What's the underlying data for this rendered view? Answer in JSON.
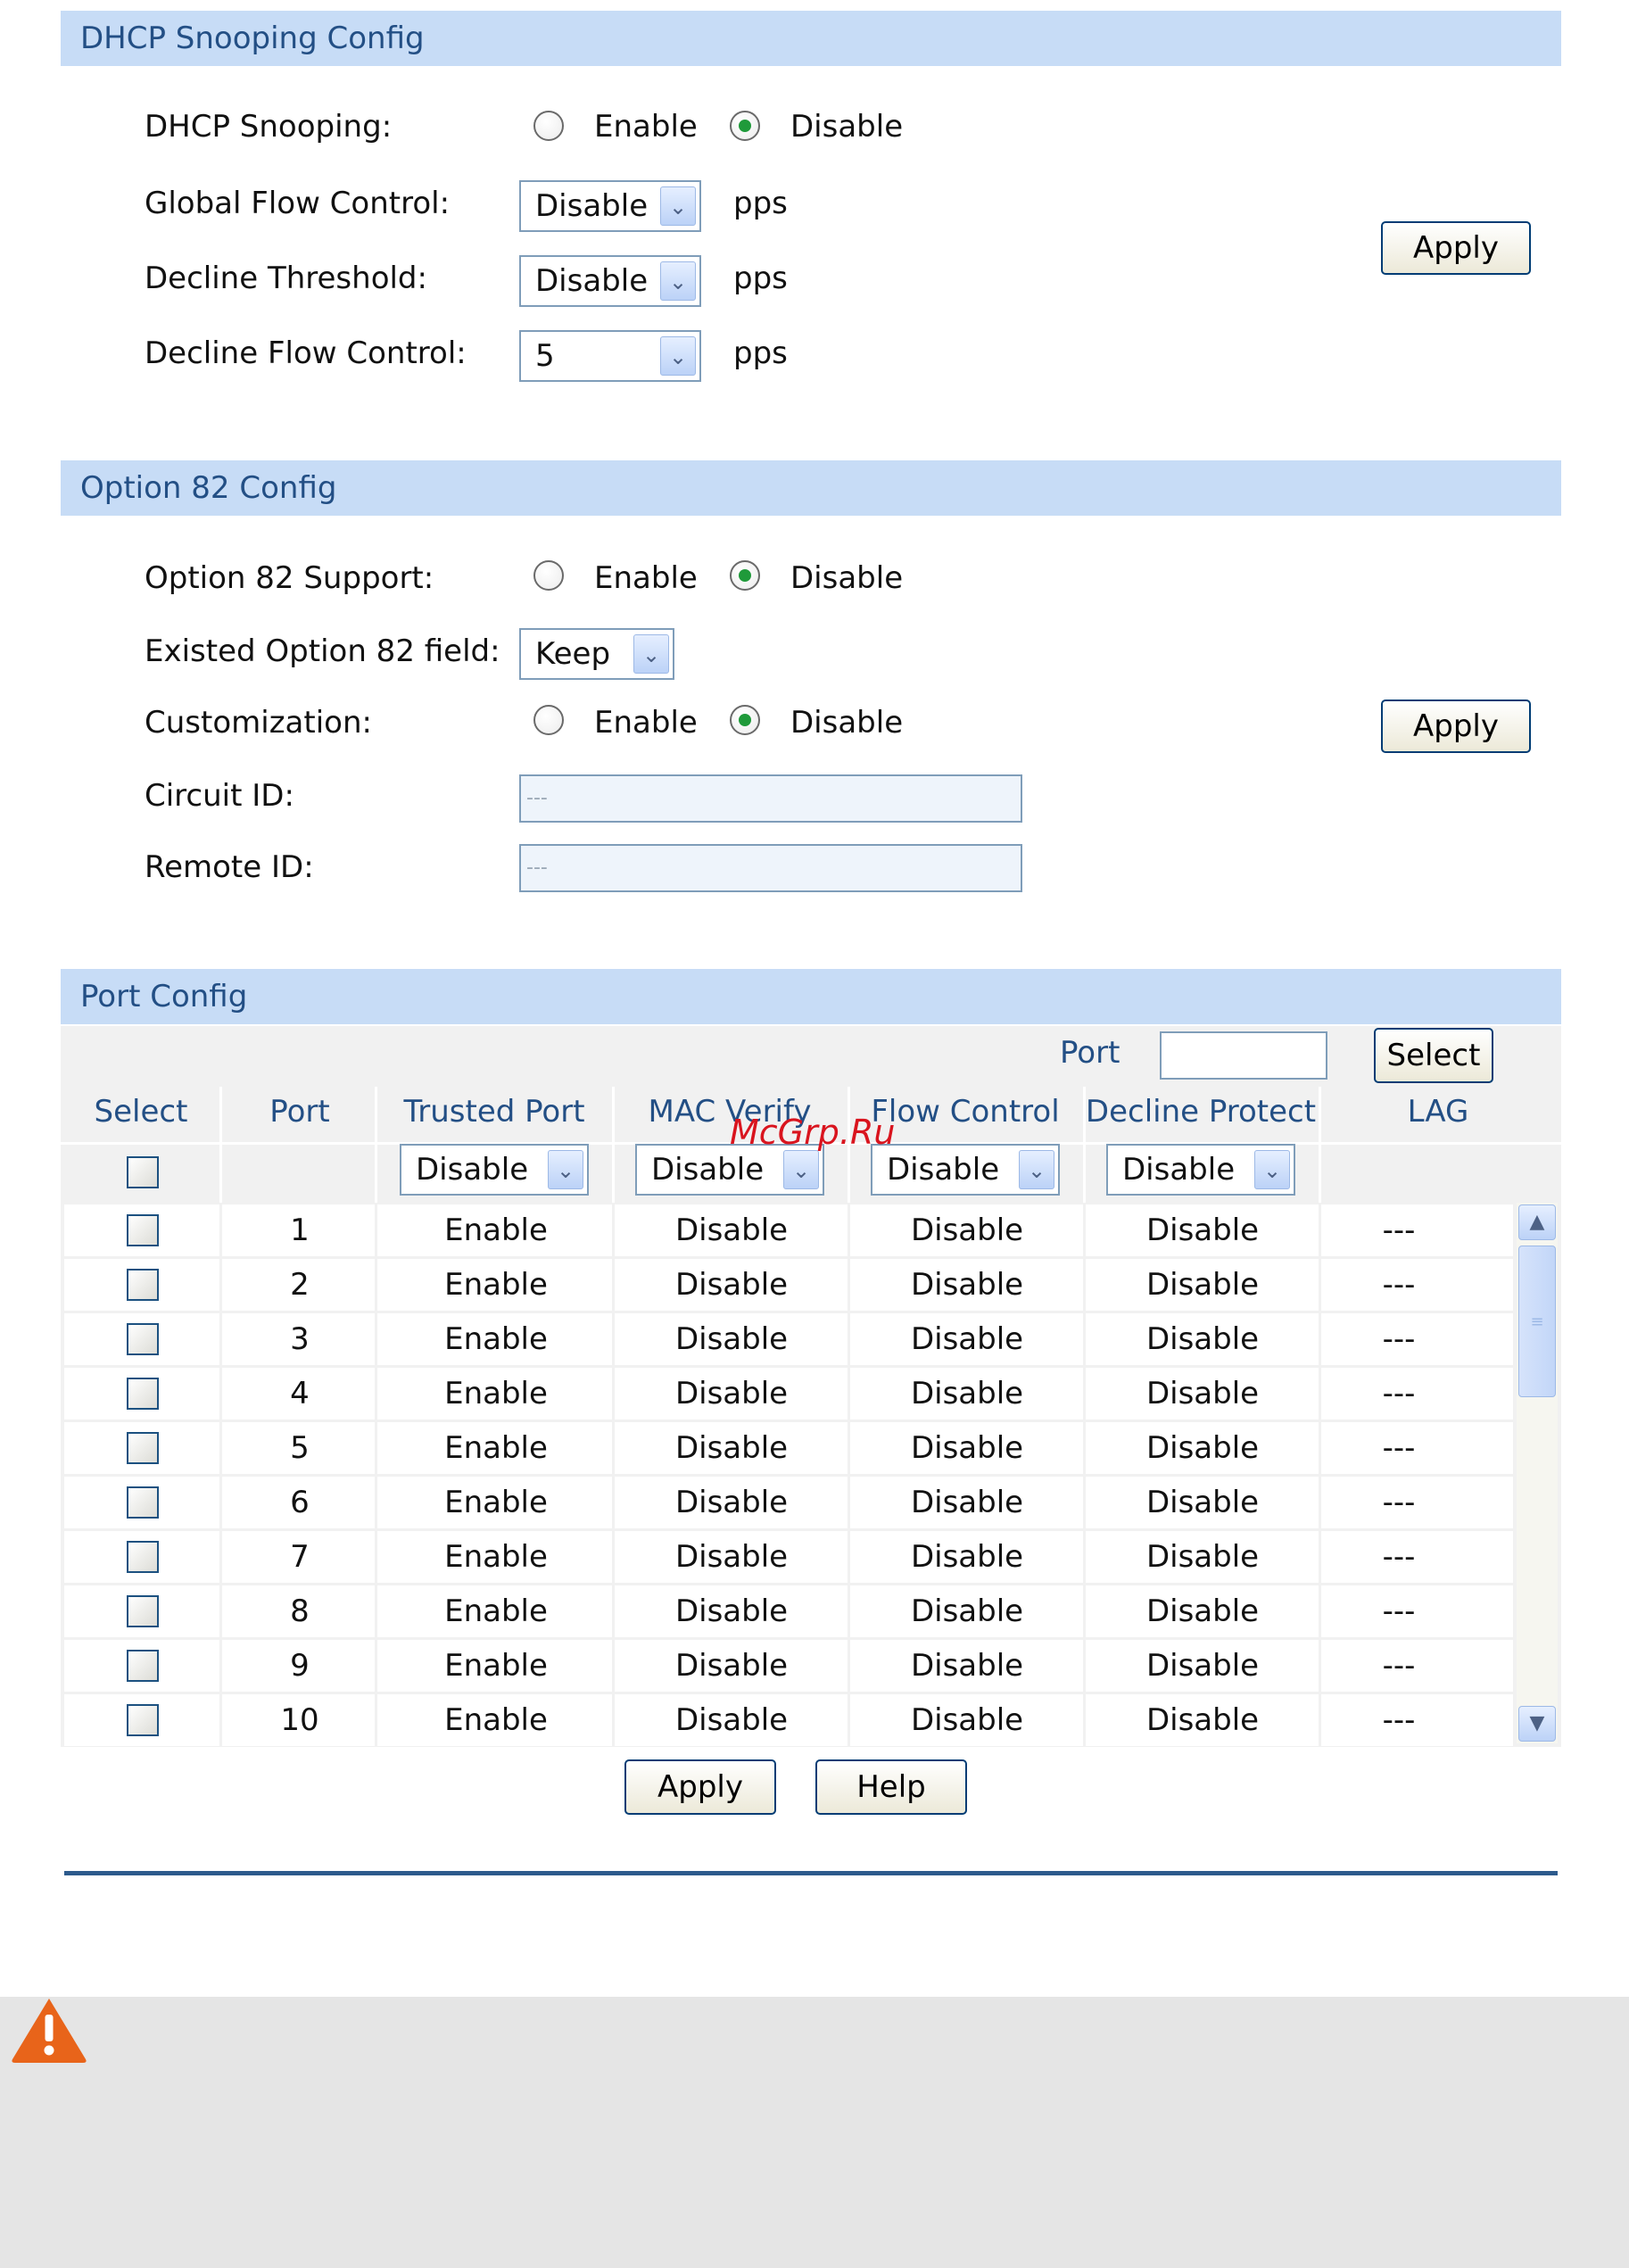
{
  "dhcp": {
    "title": "DHCP Snooping Config",
    "snooping_label": "DHCP Snooping:",
    "enable_label": "Enable",
    "disable_label": "Disable",
    "global_flow_label": "Global Flow Control:",
    "global_flow_value": "Disable",
    "decline_threshold_label": "Decline Threshold:",
    "decline_threshold_value": "Disable",
    "decline_flow_label": "Decline Flow Control:",
    "decline_flow_value": "5",
    "unit": "pps",
    "apply_label": "Apply"
  },
  "option82": {
    "title": "Option 82 Config",
    "support_label": "Option 82 Support:",
    "existed_label": "Existed Option 82 field:",
    "existed_value": "Keep",
    "custom_label": "Customization:",
    "enable_label": "Enable",
    "disable_label": "Disable",
    "circuit_label": "Circuit ID:",
    "circuit_placeholder": "---",
    "remote_label": "Remote ID:",
    "remote_placeholder": "---",
    "apply_label": "Apply"
  },
  "port_config": {
    "title": "Port Config",
    "port_search_label": "Port",
    "select_button": "Select",
    "columns": [
      "Select",
      "Port",
      "Trusted Port",
      "MAC Verify",
      "Flow Control",
      "Decline Protect",
      "LAG"
    ],
    "filters": [
      "Disable",
      "Disable",
      "Disable",
      "Disable"
    ],
    "rows": [
      {
        "port": "1",
        "trusted": "Enable",
        "mac": "Disable",
        "flow": "Disable",
        "decline": "Disable",
        "lag": "---"
      },
      {
        "port": "2",
        "trusted": "Enable",
        "mac": "Disable",
        "flow": "Disable",
        "decline": "Disable",
        "lag": "---"
      },
      {
        "port": "3",
        "trusted": "Enable",
        "mac": "Disable",
        "flow": "Disable",
        "decline": "Disable",
        "lag": "---"
      },
      {
        "port": "4",
        "trusted": "Enable",
        "mac": "Disable",
        "flow": "Disable",
        "decline": "Disable",
        "lag": "---"
      },
      {
        "port": "5",
        "trusted": "Enable",
        "mac": "Disable",
        "flow": "Disable",
        "decline": "Disable",
        "lag": "---"
      },
      {
        "port": "6",
        "trusted": "Enable",
        "mac": "Disable",
        "flow": "Disable",
        "decline": "Disable",
        "lag": "---"
      },
      {
        "port": "7",
        "trusted": "Enable",
        "mac": "Disable",
        "flow": "Disable",
        "decline": "Disable",
        "lag": "---"
      },
      {
        "port": "8",
        "trusted": "Enable",
        "mac": "Disable",
        "flow": "Disable",
        "decline": "Disable",
        "lag": "---"
      },
      {
        "port": "9",
        "trusted": "Enable",
        "mac": "Disable",
        "flow": "Disable",
        "decline": "Disable",
        "lag": "---"
      },
      {
        "port": "10",
        "trusted": "Enable",
        "mac": "Disable",
        "flow": "Disable",
        "decline": "Disable",
        "lag": "---"
      }
    ],
    "apply_label": "Apply",
    "help_label": "Help"
  },
  "watermark": "McGrp.Ru",
  "colors": {
    "section_bar": "#c7dcf6",
    "section_text": "#234f85",
    "radio_selected": "#1f9a3a",
    "divider": "#2c5a8c",
    "warning_icon": "#e8641a"
  },
  "icons": [
    "radio-icon",
    "dropdown-arrow-icon",
    "checkbox-icon",
    "scroll-up-icon",
    "scroll-down-icon",
    "warning-icon"
  ]
}
